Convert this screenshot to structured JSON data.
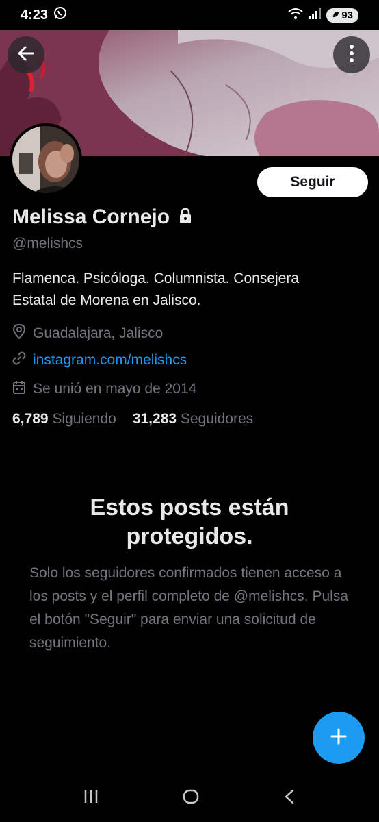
{
  "status_bar": {
    "time": "4:23",
    "battery": "93"
  },
  "profile": {
    "follow_label": "Seguir",
    "name": "Melissa Cornejo",
    "handle": "@melishcs",
    "bio_line1": "Flamenca. Psicóloga. Columnista. Consejera",
    "bio_line2": "Estatal de Morena en Jalisco.",
    "location": "Guadalajara, Jalisco",
    "website": "instagram.com/melishcs",
    "joined": "Se unió en mayo de 2014",
    "following_count": "6,789",
    "following_label": "Siguiendo",
    "followers_count": "31,283",
    "followers_label": "Seguidores"
  },
  "protected": {
    "title_line1": "Estos posts están",
    "title_line2": "protegidos.",
    "body": "Solo los seguidores confirmados tienen acceso a los posts y el perfil completo de @melishcs. Pulsa el botón \"Seguir\" para enviar una solicitud de seguimiento."
  },
  "colors": {
    "accent": "#1d9bf0",
    "background": "#000000",
    "secondary_text": "#71767b"
  },
  "icons": [
    "whatsapp-icon",
    "wifi-icon",
    "signal-icon",
    "back-arrow-icon",
    "more-options-icon",
    "lock-icon",
    "location-icon",
    "link-icon",
    "calendar-icon",
    "plus-icon",
    "recents-icon",
    "home-icon",
    "back-nav-icon"
  ]
}
